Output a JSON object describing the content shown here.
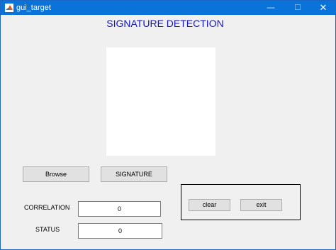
{
  "window": {
    "title": "gui_target"
  },
  "titlebar": {
    "minimize_glyph": "—",
    "maximize_glyph": "☐",
    "close_glyph": "✕"
  },
  "main": {
    "heading": "SIGNATURE DETECTION",
    "buttons": {
      "browse": "Browse",
      "signature": "SIGNATURE"
    },
    "panel": {
      "clear": "clear",
      "exit": "exit"
    },
    "fields": {
      "correlation_label": "CORRELATION",
      "correlation_value": "0",
      "status_label": "STATUS",
      "status_value": "0"
    }
  },
  "icons": {
    "app": "matlab-icon"
  },
  "colors": {
    "titlebar": "#0a73d9",
    "heading": "#1515c9",
    "background": "#f0f0f0"
  }
}
